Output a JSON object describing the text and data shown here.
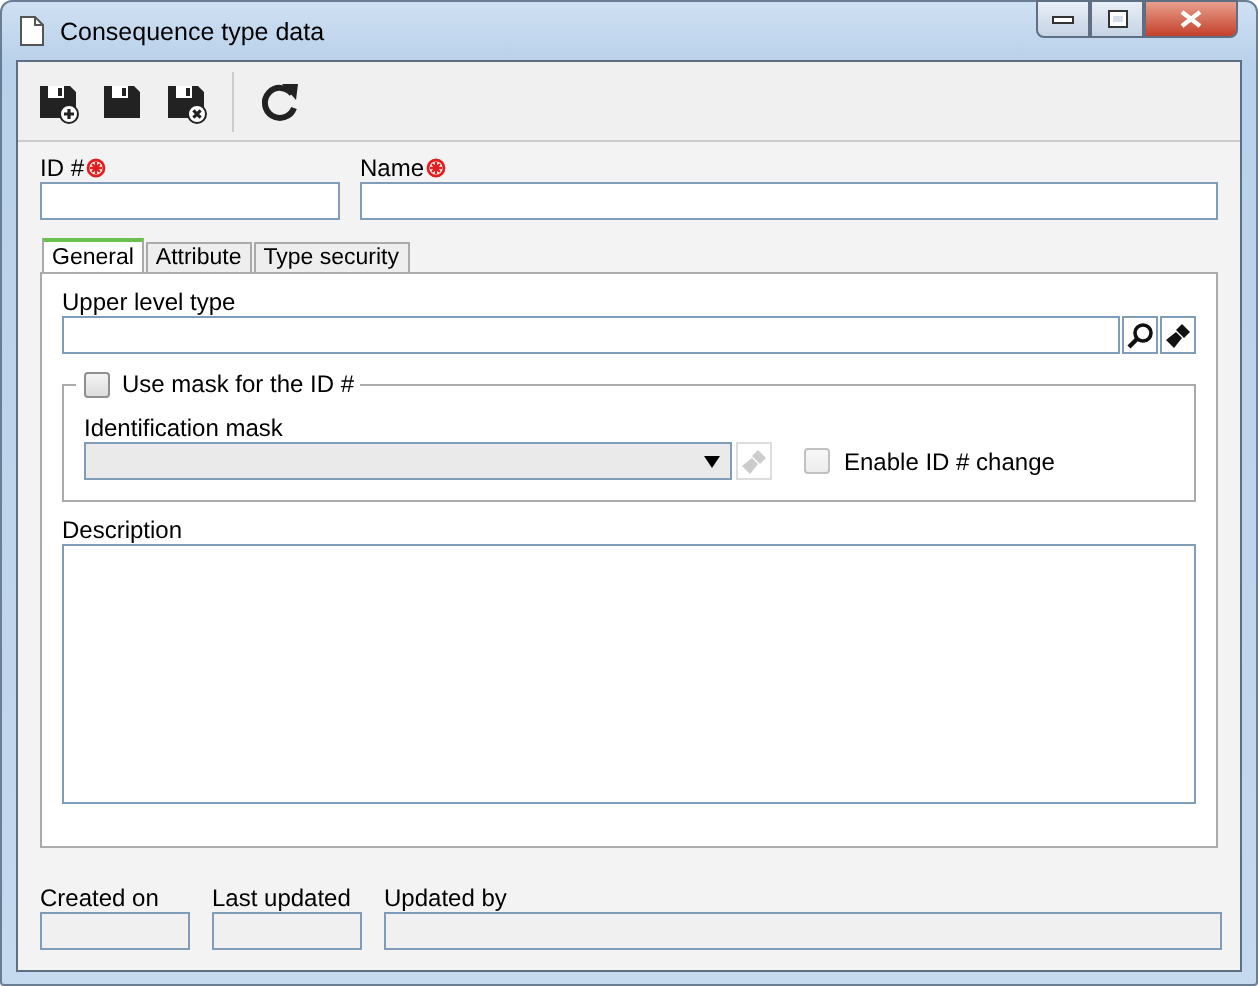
{
  "window": {
    "title": "Consequence type data"
  },
  "fields": [
    {
      "label": "ID #",
      "required": true
    },
    {
      "label": "Name",
      "required": true
    }
  ],
  "tabs": [
    {
      "label": "General",
      "selected": true
    },
    {
      "label": "Attribute",
      "selected": false
    },
    {
      "label": "Type security",
      "selected": false
    }
  ],
  "general": {
    "upper_level_type": {
      "label": "Upper level type"
    },
    "use_mask": {
      "label": "Use mask for the ID #",
      "checked": false
    },
    "identification_mask": {
      "label": "Identification mask",
      "disabled": true
    },
    "enable_id_change": {
      "label": "Enable ID # change",
      "checked": false,
      "disabled": true
    },
    "description": {
      "label": "Description"
    }
  },
  "footer": [
    {
      "label": "Created on",
      "disabled": true
    },
    {
      "label": "Last updated",
      "disabled": true
    },
    {
      "label": "Updated by",
      "disabled": true
    }
  ]
}
